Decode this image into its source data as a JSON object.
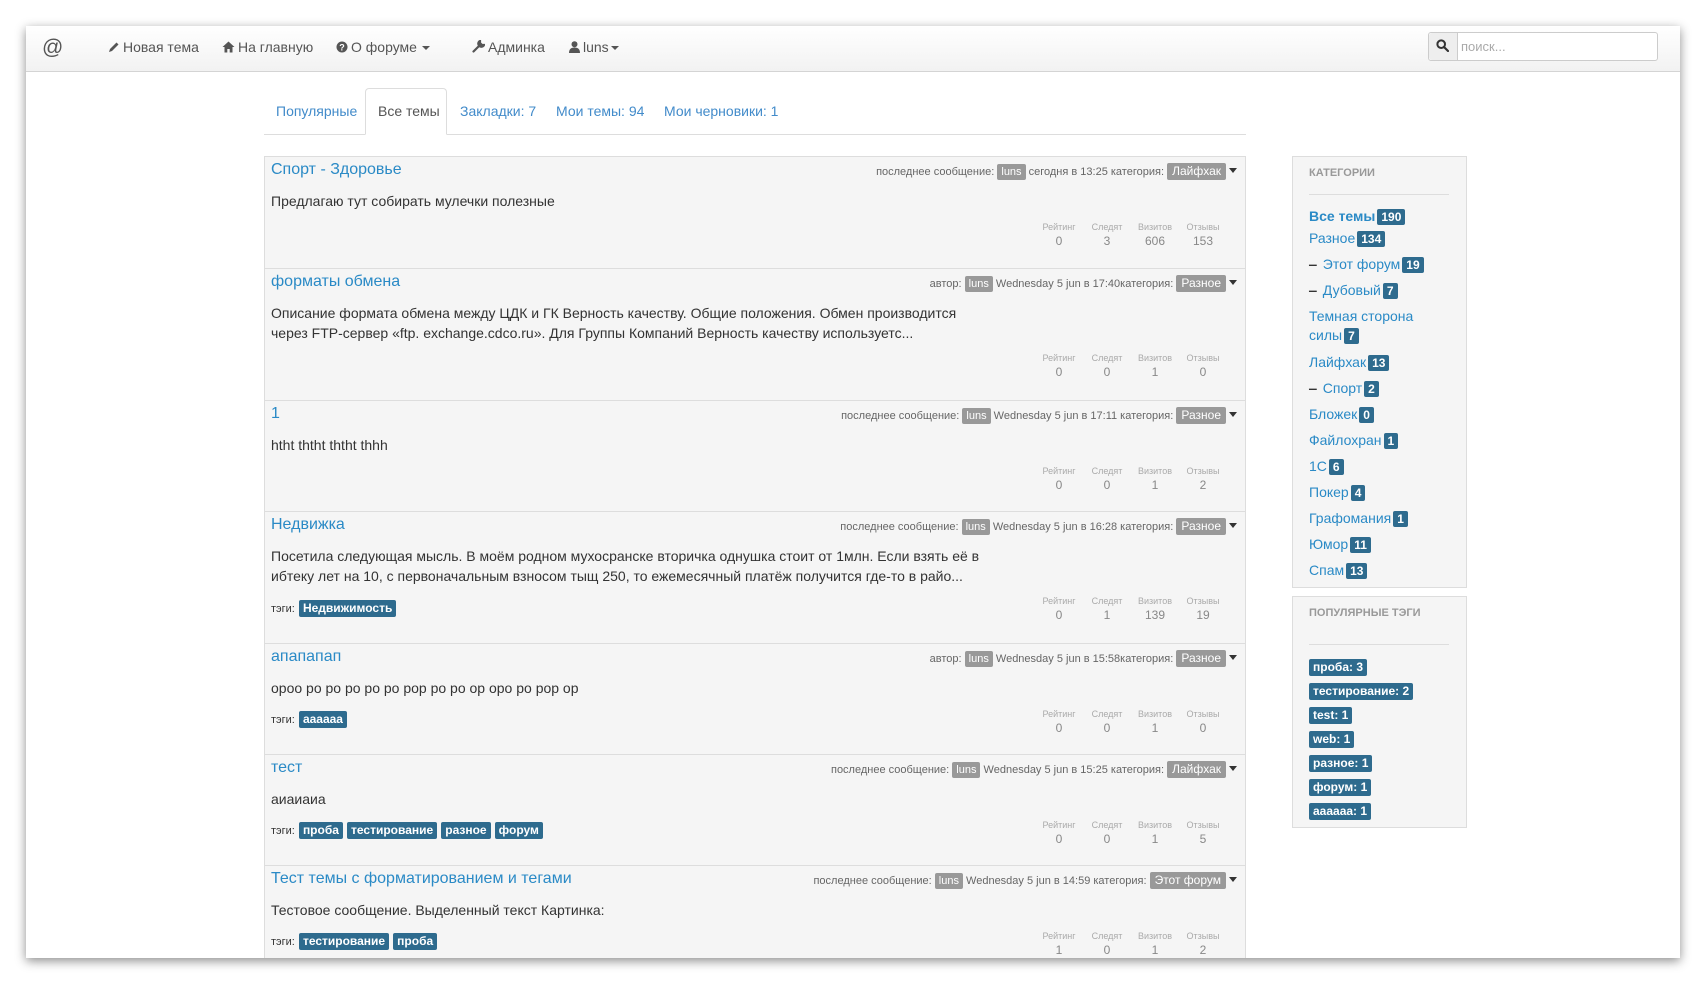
{
  "navbar": {
    "brand": "@",
    "new_topic": "Новая тема",
    "home": "На главную",
    "about": "О форуме",
    "admin": "Админка",
    "user": "luns",
    "search_placeholder": "поиск..."
  },
  "tabs": [
    {
      "label": "Популярные",
      "active": false
    },
    {
      "label": "Все темы",
      "active": true
    },
    {
      "label": "Закладки: 7",
      "active": false
    },
    {
      "label": "Мои темы: 94",
      "active": false
    },
    {
      "label": "Мои черновики: 1",
      "active": false
    }
  ],
  "stat_labels": {
    "rating": "Рейтинг",
    "follow": "Следят",
    "visits": "Визитов",
    "replies": "Отзывы"
  },
  "tags_label": "тэги:",
  "topics": [
    {
      "title": "Спорт - Здоровье",
      "meta_prefix": "последнее сообщение:",
      "user": "luns",
      "date": "сегодня в 13:25 категория:",
      "category": "Лайфхак",
      "body": "Предлагаю тут собирать мулечки полезные",
      "tags": [],
      "stats": {
        "rating": "0",
        "follow": "3",
        "visits": "606",
        "replies": "153"
      }
    },
    {
      "title": "форматы обмена",
      "meta_prefix": "автор:",
      "user": "luns",
      "date": "Wednesday 5 jun в 17:40категория:",
      "category": "Разное",
      "body": "Описание формата обмена между ЦДК и ГК Верность качеству. Общие положения. Обмен производится через FTP-сервер «ftp. exchange.cdco.ru». Для Группы Компаний Верность качеству используетс...",
      "tags": [],
      "stats": {
        "rating": "0",
        "follow": "0",
        "visits": "1",
        "replies": "0"
      }
    },
    {
      "title": "1",
      "meta_prefix": "последнее сообщение:",
      "user": "luns",
      "date": "Wednesday 5 jun в 17:11 категория:",
      "category": "Разное",
      "body": "htht ththt ththt thhh",
      "tags": [],
      "stats": {
        "rating": "0",
        "follow": "0",
        "visits": "1",
        "replies": "2"
      }
    },
    {
      "title": "Недвижка",
      "meta_prefix": "последнее сообщение:",
      "user": "luns",
      "date": "Wednesday 5 jun в 16:28 категория:",
      "category": "Разное",
      "body": "Посетила следующая мысль. В моём родном мухосранске вторичка однушка стоит от 1млн. Если взять её в ибтеку лет на 10, с первоначальным взносом тыщ 250, то ежемесячный платёж получится где-то в райо...",
      "tags": [
        "Недвижимость"
      ],
      "stats": {
        "rating": "0",
        "follow": "1",
        "visits": "139",
        "replies": "19"
      }
    },
    {
      "title": "апапапап",
      "meta_prefix": "автор:",
      "user": "luns",
      "date": "Wednesday 5 jun в 15:58категория:",
      "category": "Разное",
      "body": "ороо ро ро ро ро ро рор ро ро ор оро ро рор ор",
      "tags": [
        "аааааа"
      ],
      "stats": {
        "rating": "0",
        "follow": "0",
        "visits": "1",
        "replies": "0"
      }
    },
    {
      "title": "тест",
      "meta_prefix": "последнее сообщение:",
      "user": "luns",
      "date": "Wednesday 5 jun в 15:25 категория:",
      "category": "Лайфхак",
      "body": "аиаиаиа",
      "tags": [
        "проба",
        "тестирование",
        "разное",
        "форум"
      ],
      "stats": {
        "rating": "0",
        "follow": "0",
        "visits": "1",
        "replies": "5"
      }
    },
    {
      "title": "Тест темы с форматированием и тегами",
      "meta_prefix": "последнее сообщение:",
      "user": "luns",
      "date": "Wednesday 5 jun в 14:59 категория:",
      "category": "Этот форум",
      "body": "Тестовое сообщение. Выделенный текст Картинка:",
      "tags": [
        "тестирование",
        "проба"
      ],
      "stats": {
        "rating": "1",
        "follow": "0",
        "visits": "1",
        "replies": "2"
      }
    }
  ],
  "sidebar": {
    "categories_title": "КАТЕГОРИИ",
    "categories": [
      {
        "label": "Все темы",
        "count": "190",
        "sub": false,
        "bold": true
      },
      {
        "label": "Разное",
        "count": "134",
        "sub": false,
        "bold": false
      },
      {
        "label": "Этот форум",
        "count": "19",
        "sub": true,
        "bold": false
      },
      {
        "label": "Дубовый",
        "count": "7",
        "sub": true,
        "bold": false
      },
      {
        "label": "Темная сторона",
        "label2": "силы",
        "count": "7",
        "sub": false,
        "bold": false
      },
      {
        "label": "Лайфхак",
        "count": "13",
        "sub": false,
        "bold": false
      },
      {
        "label": "Спорт",
        "count": "2",
        "sub": true,
        "bold": false
      },
      {
        "label": "Бложек",
        "count": "0",
        "sub": false,
        "bold": false
      },
      {
        "label": "Файлохран",
        "count": "1",
        "sub": false,
        "bold": false
      },
      {
        "label": "1С",
        "count": "6",
        "sub": false,
        "bold": false
      },
      {
        "label": "Покер",
        "count": "4",
        "sub": false,
        "bold": false
      },
      {
        "label": "Графомания",
        "count": "1",
        "sub": false,
        "bold": false
      },
      {
        "label": "Юмор",
        "count": "11",
        "sub": false,
        "bold": false
      },
      {
        "label": "Спам",
        "count": "13",
        "sub": false,
        "bold": false
      }
    ],
    "tags_title": "ПОПУЛЯРНЫЕ ТЭГИ",
    "popular_tags": [
      "проба: 3",
      "тестирование: 2",
      "test: 1",
      "web: 1",
      "разное: 1",
      "форум: 1",
      "аааааа: 1"
    ]
  }
}
